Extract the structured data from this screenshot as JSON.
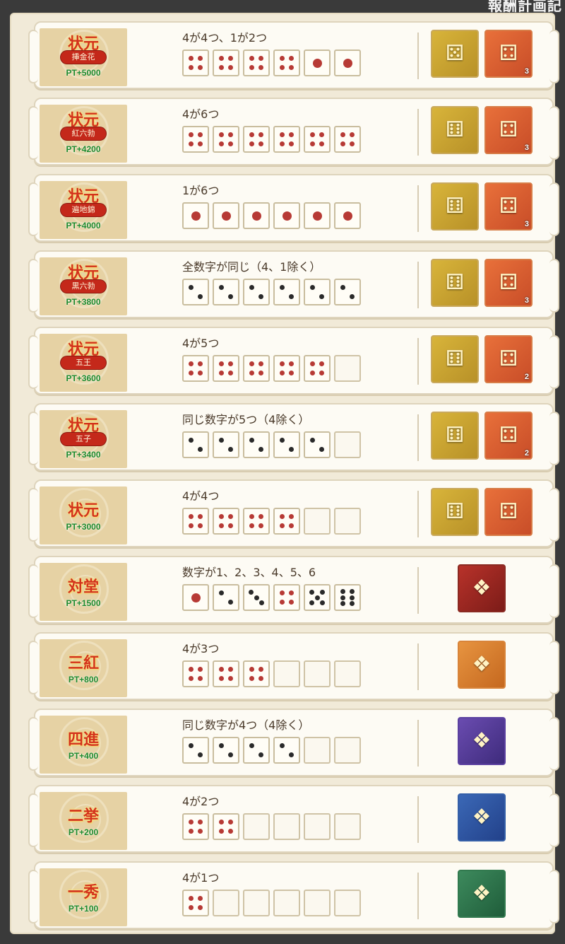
{
  "header": {
    "corner_text": "報酬計画記"
  },
  "colors": {
    "rank_red": "#d3321b",
    "pt_green": "#1d8a2c",
    "pip_red": "#b73a35",
    "pip_black": "#2a2a2a"
  },
  "rows": [
    {
      "title": "状元",
      "sub": "挿金花",
      "pt": "PT+5000",
      "condition": "4が4つ、1が2つ",
      "dice": [
        [
          "4",
          "r"
        ],
        [
          "4",
          "r"
        ],
        [
          "4",
          "r"
        ],
        [
          "4",
          "r"
        ],
        [
          "1",
          "r"
        ],
        [
          "1",
          "r"
        ]
      ],
      "rewards": [
        {
          "icon": "gold-dice-chest-icon",
          "style": "chest-gold",
          "count": ""
        },
        {
          "icon": "ticket-icon",
          "style": "ticket",
          "count": "3"
        }
      ]
    },
    {
      "title": "状元",
      "sub": "紅六勃",
      "pt": "PT+4200",
      "condition": "4が6つ",
      "dice": [
        [
          "4",
          "r"
        ],
        [
          "4",
          "r"
        ],
        [
          "4",
          "r"
        ],
        [
          "4",
          "r"
        ],
        [
          "4",
          "r"
        ],
        [
          "4",
          "r"
        ]
      ],
      "rewards": [
        {
          "icon": "dice-chest-icon",
          "style": "chest-gold",
          "count": ""
        },
        {
          "icon": "ticket-icon",
          "style": "ticket",
          "count": "3"
        }
      ]
    },
    {
      "title": "状元",
      "sub": "遍地錦",
      "pt": "PT+4000",
      "condition": "1が6つ",
      "dice": [
        [
          "1",
          "r"
        ],
        [
          "1",
          "r"
        ],
        [
          "1",
          "r"
        ],
        [
          "1",
          "r"
        ],
        [
          "1",
          "r"
        ],
        [
          "1",
          "r"
        ]
      ],
      "rewards": [
        {
          "icon": "dice-chest-icon",
          "style": "chest-gold",
          "count": ""
        },
        {
          "icon": "ticket-icon",
          "style": "ticket",
          "count": "3"
        }
      ]
    },
    {
      "title": "状元",
      "sub": "黒六勃",
      "pt": "PT+3800",
      "condition": "全数字が同じ（4、1除く）",
      "dice": [
        [
          "2",
          "b"
        ],
        [
          "2",
          "b"
        ],
        [
          "2",
          "b"
        ],
        [
          "2",
          "b"
        ],
        [
          "2",
          "b"
        ],
        [
          "2",
          "b"
        ]
      ],
      "rewards": [
        {
          "icon": "dice-chest-icon",
          "style": "chest-gold",
          "count": ""
        },
        {
          "icon": "ticket-icon",
          "style": "ticket",
          "count": "3"
        }
      ]
    },
    {
      "title": "状元",
      "sub": "五王",
      "pt": "PT+3600",
      "condition": "4が5つ",
      "dice": [
        [
          "4",
          "r"
        ],
        [
          "4",
          "r"
        ],
        [
          "4",
          "r"
        ],
        [
          "4",
          "r"
        ],
        [
          "4",
          "r"
        ],
        [
          "0",
          ""
        ]
      ],
      "rewards": [
        {
          "icon": "dice-chest-icon",
          "style": "chest-gold",
          "count": ""
        },
        {
          "icon": "ticket-icon",
          "style": "ticket",
          "count": "2"
        }
      ]
    },
    {
      "title": "状元",
      "sub": "五子",
      "pt": "PT+3400",
      "condition": "同じ数字が5つ（4除く）",
      "dice": [
        [
          "2",
          "b"
        ],
        [
          "2",
          "b"
        ],
        [
          "2",
          "b"
        ],
        [
          "2",
          "b"
        ],
        [
          "2",
          "b"
        ],
        [
          "0",
          ""
        ]
      ],
      "rewards": [
        {
          "icon": "dice-chest-icon",
          "style": "chest-gold",
          "count": ""
        },
        {
          "icon": "ticket-icon",
          "style": "ticket",
          "count": "2"
        }
      ]
    },
    {
      "title": "状元",
      "sub": "",
      "pt": "PT+3000",
      "condition": "4が4つ",
      "dice": [
        [
          "4",
          "r"
        ],
        [
          "4",
          "r"
        ],
        [
          "4",
          "r"
        ],
        [
          "4",
          "r"
        ],
        [
          "0",
          ""
        ],
        [
          "0",
          ""
        ]
      ],
      "rewards": [
        {
          "icon": "dice-chest-icon",
          "style": "chest-gold",
          "count": ""
        },
        {
          "icon": "ticket-icon",
          "style": "ticket",
          "count": ""
        }
      ]
    },
    {
      "title": "対堂",
      "sub": "",
      "pt": "PT+1500",
      "condition": "数字が1、2、3、4、5、6",
      "dice": [
        [
          "1",
          "r"
        ],
        [
          "2",
          "b"
        ],
        [
          "3",
          "b"
        ],
        [
          "4",
          "r"
        ],
        [
          "5",
          "b"
        ],
        [
          "6",
          "b"
        ]
      ],
      "rewards": [
        {
          "icon": "red-chest-icon",
          "style": "chest-red",
          "count": ""
        }
      ]
    },
    {
      "title": "三紅",
      "sub": "",
      "pt": "PT+800",
      "condition": "4が3つ",
      "dice": [
        [
          "4",
          "r"
        ],
        [
          "4",
          "r"
        ],
        [
          "4",
          "r"
        ],
        [
          "0",
          ""
        ],
        [
          "0",
          ""
        ],
        [
          "0",
          ""
        ]
      ],
      "rewards": [
        {
          "icon": "orange-chest-icon",
          "style": "chest-orange",
          "count": ""
        }
      ]
    },
    {
      "title": "四進",
      "sub": "",
      "pt": "PT+400",
      "condition": "同じ数字が4つ（4除く）",
      "dice": [
        [
          "2",
          "b"
        ],
        [
          "2",
          "b"
        ],
        [
          "2",
          "b"
        ],
        [
          "2",
          "b"
        ],
        [
          "0",
          ""
        ],
        [
          "0",
          ""
        ]
      ],
      "rewards": [
        {
          "icon": "purple-chest-icon",
          "style": "chest-purple",
          "count": ""
        }
      ]
    },
    {
      "title": "二挙",
      "sub": "",
      "pt": "PT+200",
      "condition": "4が2つ",
      "dice": [
        [
          "4",
          "r"
        ],
        [
          "4",
          "r"
        ],
        [
          "0",
          ""
        ],
        [
          "0",
          ""
        ],
        [
          "0",
          ""
        ],
        [
          "0",
          ""
        ]
      ],
      "rewards": [
        {
          "icon": "blue-chest-icon",
          "style": "chest-blue",
          "count": ""
        }
      ]
    },
    {
      "title": "一秀",
      "sub": "",
      "pt": "PT+100",
      "condition": "4が1つ",
      "dice": [
        [
          "4",
          "r"
        ],
        [
          "0",
          ""
        ],
        [
          "0",
          ""
        ],
        [
          "0",
          ""
        ],
        [
          "0",
          ""
        ],
        [
          "0",
          ""
        ]
      ],
      "rewards": [
        {
          "icon": "green-chest-icon",
          "style": "chest-green",
          "count": ""
        }
      ]
    }
  ]
}
